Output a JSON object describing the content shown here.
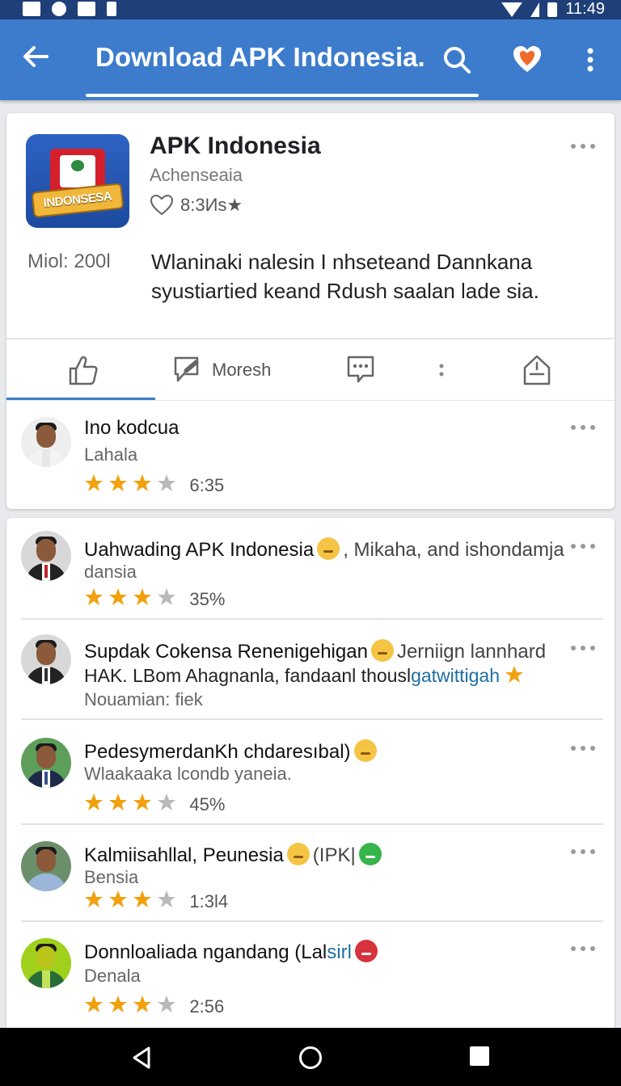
{
  "status": {
    "time": "11:49"
  },
  "app_bar": {
    "title": "Download APK Indonesia."
  },
  "app": {
    "name": "APK Indonesia",
    "developer": "Achenseaia",
    "rating_text": "8:3Иs★",
    "icon_label": "INDONSESA",
    "meta_label": "Miol:  200l",
    "description": "Wlaninaki nalesin I nhseteand Dannkana syustiartied keand Rdush saalan lade sia."
  },
  "tabs": [
    {
      "label": ""
    },
    {
      "label": "Moresh"
    },
    {
      "label": ""
    },
    {
      "label": ""
    },
    {
      "label": ""
    }
  ],
  "top_review": {
    "name": "Ino kodcua",
    "sub": "Lahala",
    "stars": 3,
    "score": "6:35"
  },
  "reviews": [
    {
      "name": "Uahwading APK Indonesia",
      "name_tail": ", Mikaha, and ishondamja",
      "sub": "dansia",
      "stars": 3,
      "score": "35%"
    },
    {
      "name": "Supdak Cokensa Renenigehigan",
      "name_tail": "Jerniign lannhard",
      "line2": "HAK. LBom Ahagnanla, fandaanl thousl",
      "line2_link": "gatwittigah",
      "sub": "Nouamian: fiek",
      "stars": 0,
      "score": ""
    },
    {
      "name": "PedesymerdanKh chdaresıbal)",
      "name_tail": "",
      "sub": "Wlaakaakа lcondb yaneia.",
      "stars": 3,
      "score": "45%"
    },
    {
      "name": "Kalmiisahllal, Peunesia",
      "name_tail": "(IPK|",
      "sub": "Bensia",
      "stars": 3,
      "score": "1:3l4"
    },
    {
      "name": "Donnloaliada ngandang (Lal",
      "name_tail": "sirl",
      "sub": "Denala",
      "stars": 3,
      "score": "2:56"
    }
  ],
  "colors": {
    "app_bar": "#3d7ccc",
    "status_bar": "#1e3f78",
    "star": "#f1a10d",
    "star_empty": "#b9b9b9"
  }
}
